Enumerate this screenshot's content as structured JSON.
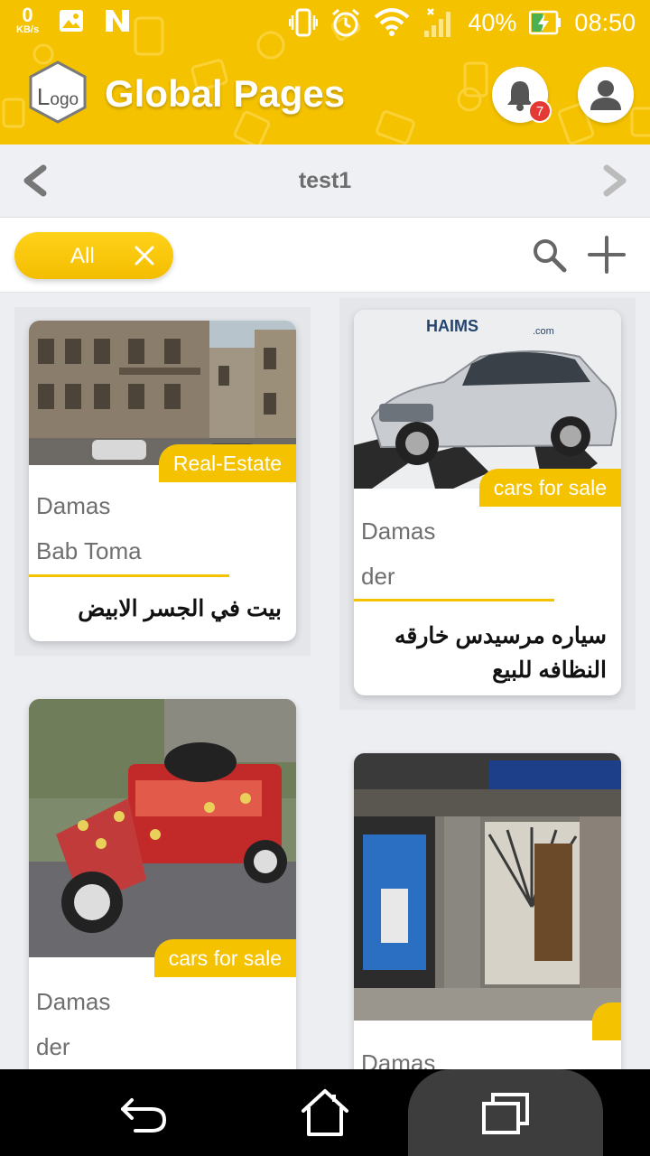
{
  "status_bar": {
    "net_speed_value": "0",
    "net_speed_unit": "KB/s",
    "battery_percent": "40%",
    "time": "08:50"
  },
  "header": {
    "logo_text_l": "L",
    "logo_text_rest": "ogo",
    "title": "Global Pages",
    "notification_count": "7"
  },
  "page_nav": {
    "page_name": "test1"
  },
  "filter": {
    "chip_label": "All"
  },
  "listings": [
    {
      "category": "Real-Estate",
      "city": "Damas",
      "area": "Bab Toma",
      "title": "بيت في الجسر الابيض"
    },
    {
      "category": "cars for sale",
      "city": "Damas",
      "area": "der",
      "title": "سياره مرسيدس خارقه النظافه للبيع",
      "photo_watermark": "HAIMS",
      "photo_watermark_suffix": ".com"
    },
    {
      "category": "cars for sale",
      "city": "Damas",
      "area": "der"
    },
    {
      "category": "",
      "city": "Damas"
    }
  ],
  "colors": {
    "accent": "#f5c200",
    "notification_badge": "#e53935"
  }
}
